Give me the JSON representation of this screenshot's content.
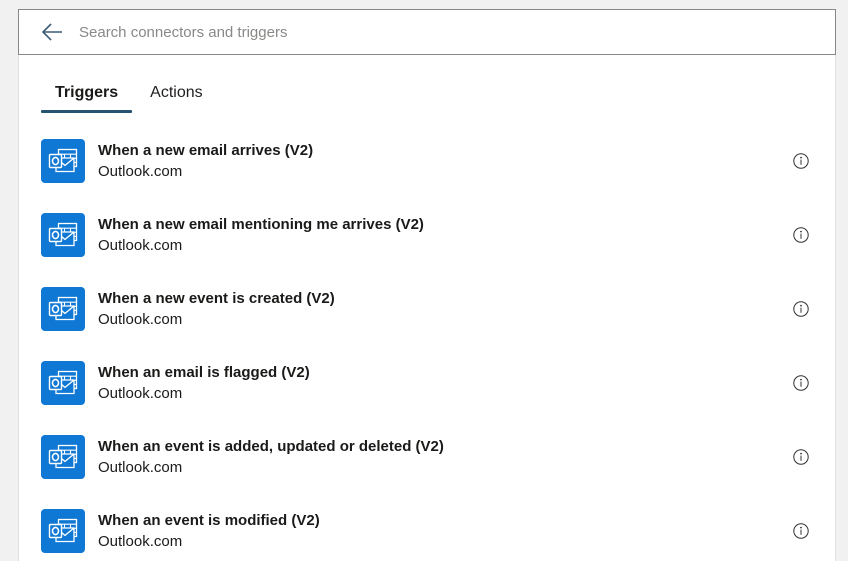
{
  "search": {
    "placeholder": "Search connectors and triggers",
    "value": "",
    "back_icon": "back-arrow-icon"
  },
  "tabs": [
    {
      "label": "Triggers",
      "active": true
    },
    {
      "label": "Actions",
      "active": false
    }
  ],
  "colors": {
    "accent_tab_underline": "#245472",
    "connector_icon_background": "#0f78d4",
    "panel_background": "#ffffff",
    "page_background": "#f1f1f1",
    "border": "#8a8886",
    "placeholder_text": "#8a8886",
    "primary_text": "#1b1a19"
  },
  "list": {
    "items": [
      {
        "title": "When a new email arrives (V2)",
        "connector": "Outlook.com",
        "icon": "outlook-icon",
        "info_icon": "info-circle-icon"
      },
      {
        "title": "When a new email mentioning me arrives (V2)",
        "connector": "Outlook.com",
        "icon": "outlook-icon",
        "info_icon": "info-circle-icon"
      },
      {
        "title": "When a new event is created (V2)",
        "connector": "Outlook.com",
        "icon": "outlook-icon",
        "info_icon": "info-circle-icon"
      },
      {
        "title": "When an email is flagged (V2)",
        "connector": "Outlook.com",
        "icon": "outlook-icon",
        "info_icon": "info-circle-icon"
      },
      {
        "title": "When an event is added, updated or deleted (V2)",
        "connector": "Outlook.com",
        "icon": "outlook-icon",
        "info_icon": "info-circle-icon"
      },
      {
        "title": "When an event is modified (V2)",
        "connector": "Outlook.com",
        "icon": "outlook-icon",
        "info_icon": "info-circle-icon"
      }
    ]
  }
}
